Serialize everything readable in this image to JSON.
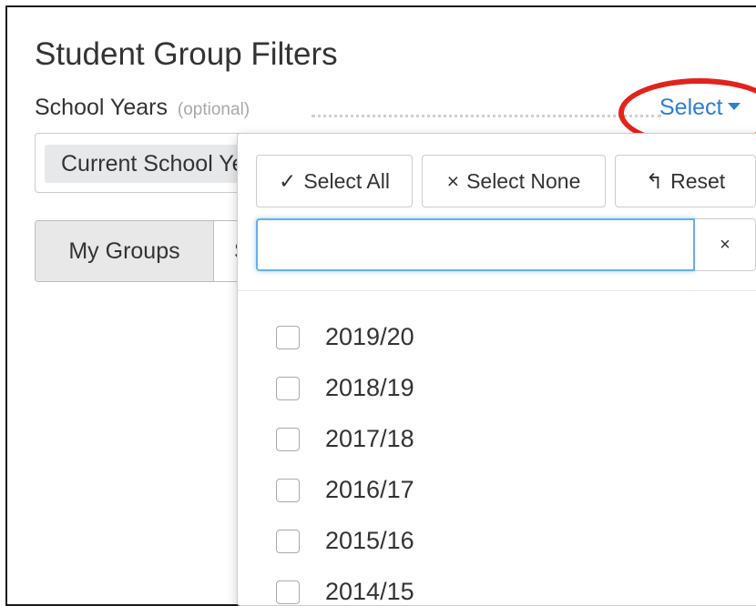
{
  "page": {
    "title": "Student Group Filters"
  },
  "school_years": {
    "label": "School Years",
    "optional": "(optional)",
    "select_link": "Select",
    "selected_chip": "Current School Year",
    "accent_color": "#2b7fd1"
  },
  "group_buttons": {
    "my_groups": "My Groups",
    "next": "Shared Groups"
  },
  "dropdown": {
    "select_all": {
      "symbol": "✓",
      "label": "Select All"
    },
    "select_none": {
      "symbol": "×",
      "label": "Select None"
    },
    "reset": {
      "symbol": "↰",
      "label": "Reset"
    },
    "search": {
      "value": "",
      "placeholder": ""
    },
    "clear_symbol": "×",
    "options": [
      "2019/20",
      "2018/19",
      "2017/18",
      "2016/17",
      "2015/16",
      "2014/15"
    ]
  },
  "annotation": {
    "highlight_color": "#e3231b"
  }
}
